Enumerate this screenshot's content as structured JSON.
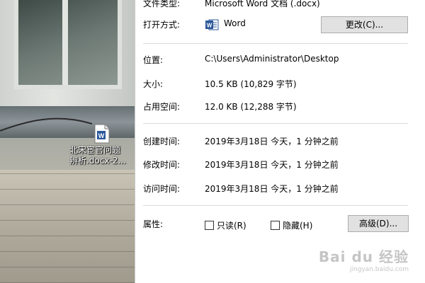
{
  "desktop": {
    "file_label_line1": "北宋宦官问题",
    "file_label_line2": "辨析.docx-2..."
  },
  "properties": {
    "file_type": {
      "label": "文件类型:",
      "value": "Microsoft Word 文档 (.docx)"
    },
    "opens_with": {
      "label": "打开方式:",
      "app": "Word",
      "change_button": "更改(C)..."
    },
    "location": {
      "label": "位置:",
      "value": "C:\\Users\\Administrator\\Desktop"
    },
    "size": {
      "label": "大小:",
      "value": "10.5 KB (10,829 字节)"
    },
    "size_on_disk": {
      "label": "占用空间:",
      "value": "12.0 KB (12,288 字节)"
    },
    "created": {
      "label": "创建时间:",
      "value": "2019年3月18日 今天，1 分钟之前"
    },
    "modified": {
      "label": "修改时间:",
      "value": "2019年3月18日 今天，1 分钟之前"
    },
    "accessed": {
      "label": "访问时间:",
      "value": "2019年3月18日 今天，1 分钟之前"
    },
    "attributes": {
      "label": "属性:",
      "readonly_label": "只读(R)",
      "readonly_checked": false,
      "hidden_label": "隐藏(H)",
      "hidden_checked": false,
      "advanced_button": "高级(D)..."
    }
  },
  "watermark": {
    "brand": "Bai du 经验",
    "url": "jingyan.baidu.com"
  },
  "colors": {
    "word_blue": "#2b579a",
    "button_bg": "#e1e1e1",
    "separator": "#dadada"
  }
}
